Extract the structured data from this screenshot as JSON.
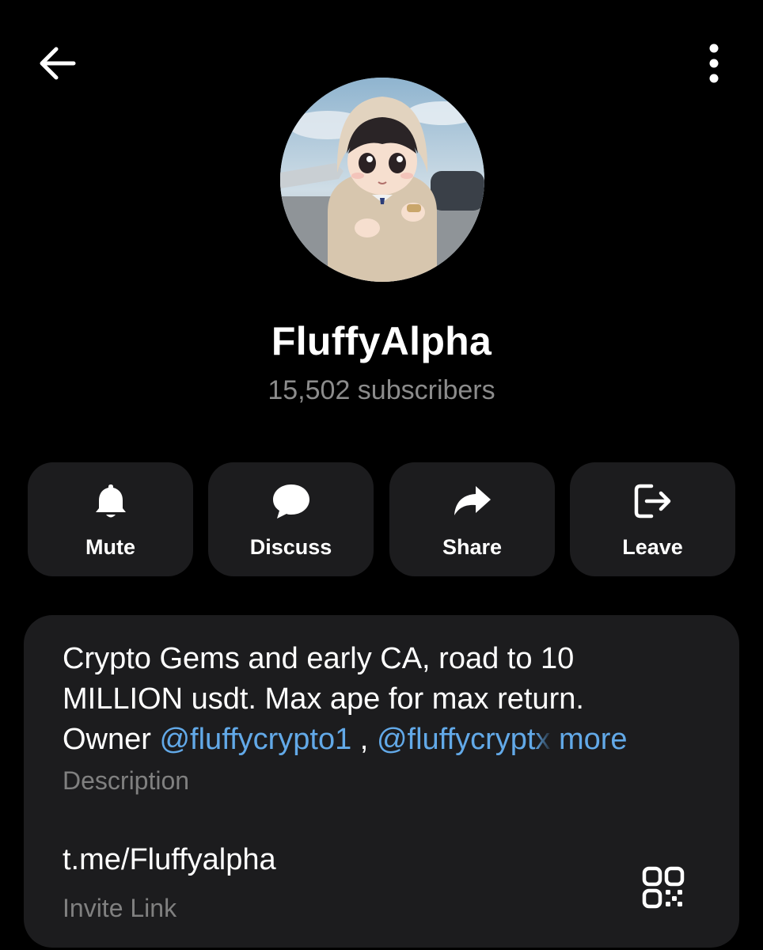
{
  "header": {
    "back_icon": "arrow-left-icon",
    "menu_icon": "more-vertical-icon"
  },
  "profile": {
    "name": "FluffyAlpha",
    "subscribers": "15,502 subscribers"
  },
  "actions": [
    {
      "label": "Mute",
      "icon": "bell-icon"
    },
    {
      "label": "Discuss",
      "icon": "chat-bubble-icon"
    },
    {
      "label": "Share",
      "icon": "share-arrow-icon"
    },
    {
      "label": "Leave",
      "icon": "leave-icon"
    }
  ],
  "info": {
    "description_line1": "Crypto Gems and early CA, road to 10",
    "description_line2": "MILLION usdt. Max ape for max return.",
    "description_owner_prefix": "Owner ",
    "mention1": "@fluffycrypto1",
    "separator": " , ",
    "mention2_visible": "@fluffycrypt",
    "mention2_faded": "x",
    "more_label": " more",
    "description_caption": "Description",
    "invite_link": "t.me/Fluffyalpha",
    "invite_caption": "Invite Link",
    "qr_icon": "qr-code-icon"
  },
  "colors": {
    "background": "#000000",
    "card": "#1c1c1e",
    "link": "#62a9e8",
    "secondary_text": "#8c8c8c"
  }
}
